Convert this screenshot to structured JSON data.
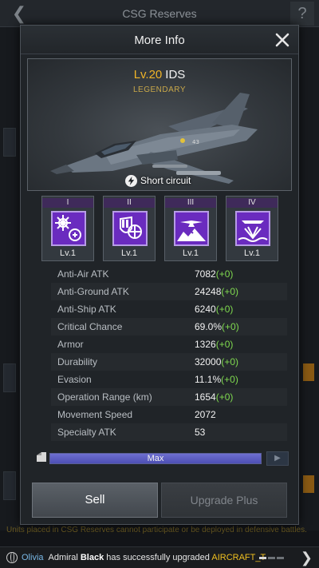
{
  "background": {
    "title": "CSG Reserves",
    "help_glyph": "?",
    "notice": "Units placed in CSG Reserves cannot participate or be deployed in defensive battles."
  },
  "modal": {
    "title": "More Info",
    "unit": {
      "level": "Lv.20",
      "name": "IDS",
      "rarity": "LEGENDARY",
      "skill": "Short circuit"
    },
    "mods": [
      {
        "slot": "I",
        "level": "Lv.1",
        "icon": "radar-burst-icon"
      },
      {
        "slot": "II",
        "level": "Lv.1",
        "icon": "shield-target-icon"
      },
      {
        "slot": "III",
        "level": "Lv.1",
        "icon": "aircraft-strike-icon"
      },
      {
        "slot": "IV",
        "level": "Lv.1",
        "icon": "ship-strike-icon"
      }
    ],
    "stats": [
      {
        "name": "Anti-Air ATK",
        "value": "7082",
        "bonus": "(+0)"
      },
      {
        "name": "Anti-Ground ATK",
        "value": "24248",
        "bonus": "(+0)"
      },
      {
        "name": "Anti-Ship ATK",
        "value": "6240",
        "bonus": "(+0)"
      },
      {
        "name": "Critical Chance",
        "value": "69.0%",
        "bonus": "(+0)"
      },
      {
        "name": "Armor",
        "value": "1326",
        "bonus": "(+0)"
      },
      {
        "name": "Durability",
        "value": "32000",
        "bonus": "(+0)"
      },
      {
        "name": "Evasion",
        "value": "11.1%",
        "bonus": "(+0)"
      },
      {
        "name": "Operation Range (km)",
        "value": "1654",
        "bonus": "(+0)"
      },
      {
        "name": "Movement Speed",
        "value": "2072",
        "bonus": ""
      },
      {
        "name": "Specialty ATK",
        "value": "53",
        "bonus": ""
      }
    ],
    "progress": {
      "label": "Max",
      "fill": 1.0
    },
    "buttons": {
      "sell": "Sell",
      "upgrade": "Upgrade Plus"
    }
  },
  "ticker": {
    "sender": "Olivia",
    "parts": [
      {
        "text": "Admiral ",
        "style": "plain"
      },
      {
        "text": "Black",
        "style": "hl-white"
      },
      {
        "text": " has successfully upgraded ",
        "style": "plain"
      },
      {
        "text": "AIRCRAFT_T",
        "style": "hl-yellow"
      }
    ]
  },
  "colors": {
    "level_gold": "#f0b428",
    "bonus_green": "#7fd94f",
    "mod_purple": "#6a2bbf",
    "progress_blue": "#5657c0",
    "ticker_highlight": "#f0c020"
  }
}
